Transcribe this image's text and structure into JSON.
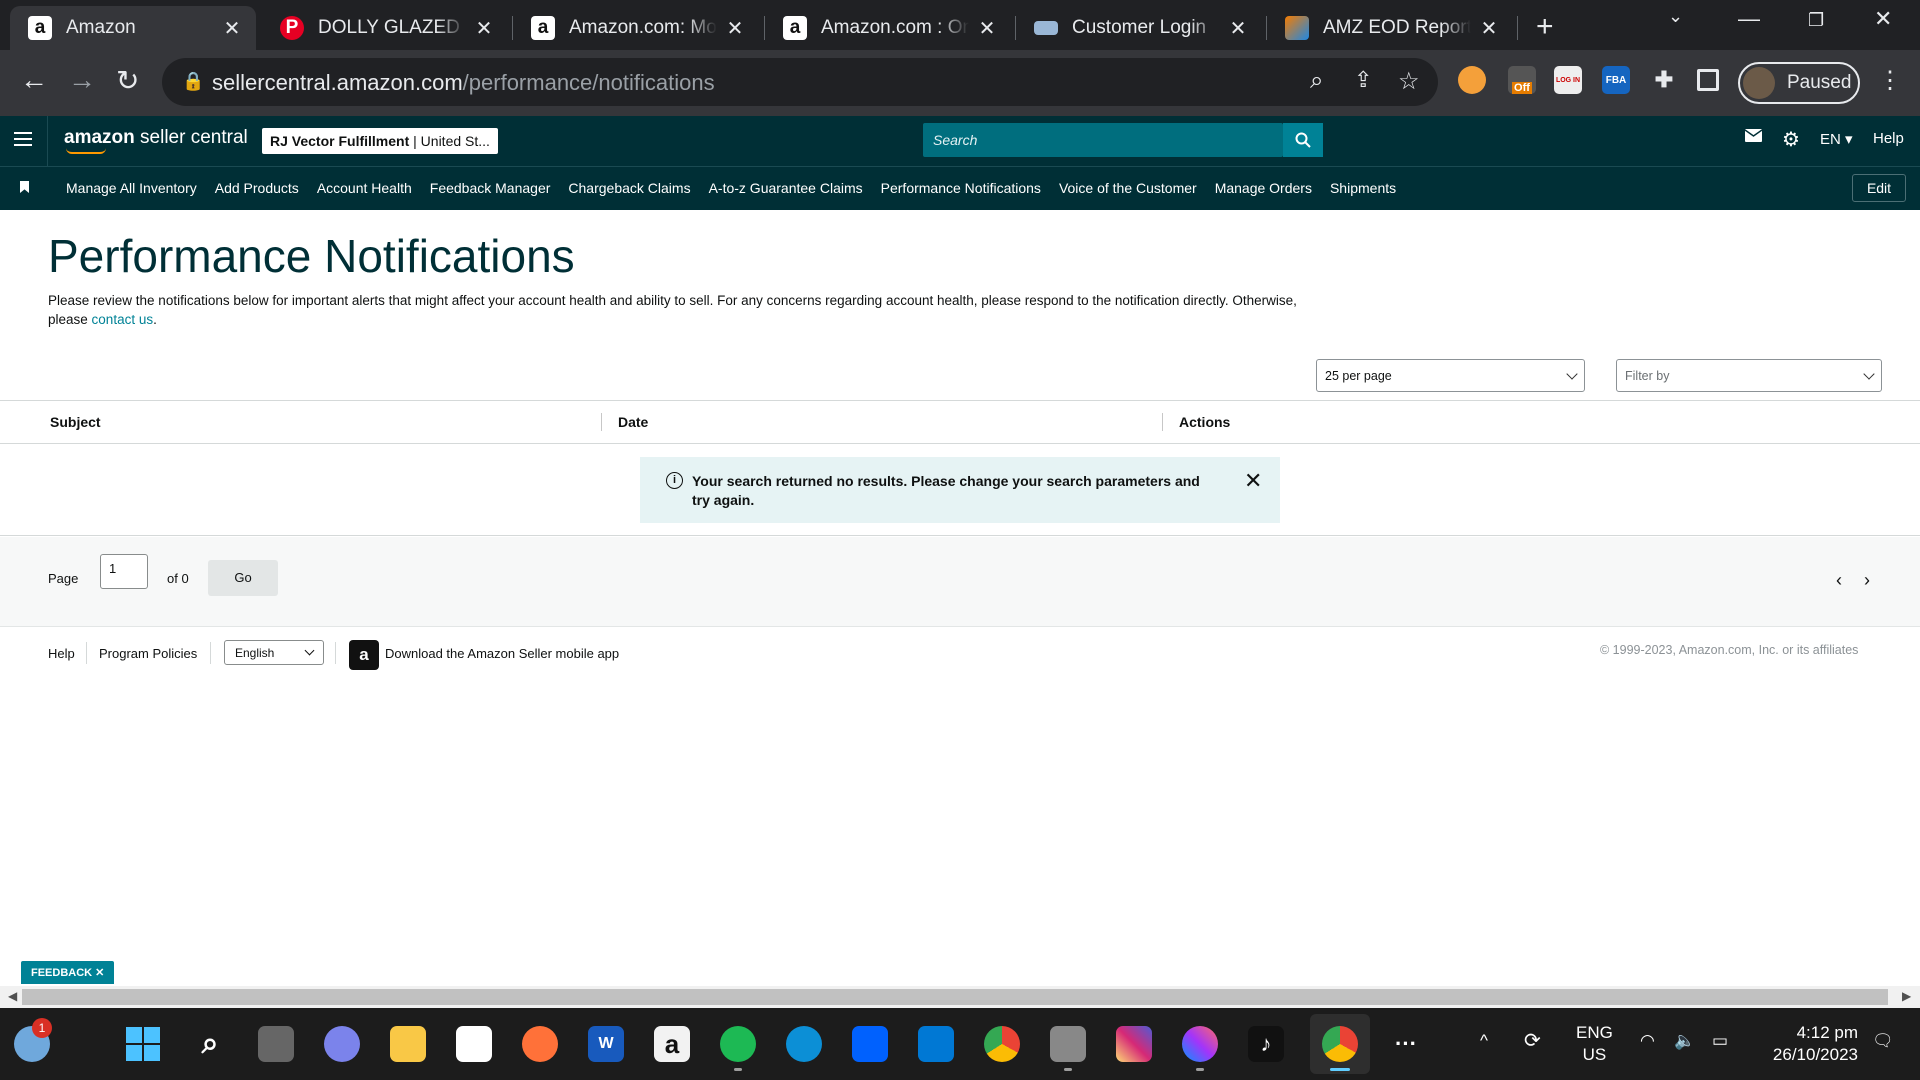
{
  "browser": {
    "tabs": [
      {
        "title": "Amazon",
        "favicon": "amazon-a",
        "active": true
      },
      {
        "title": "DOLLY GLAZED MI",
        "favicon": "pinterest-p"
      },
      {
        "title": "Amazon.com: Mon",
        "favicon": "amazon-a"
      },
      {
        "title": "Amazon.com : Ont",
        "favicon": "amazon-a"
      },
      {
        "title": "Customer Login",
        "favicon": "login-card"
      },
      {
        "title": "AMZ EOD Report",
        "favicon": "report-logo"
      }
    ],
    "url_host": "sellercentral.amazon.com",
    "url_path": "/performance/notifications",
    "extensions": {
      "off_badge": "Off",
      "login_ext": "LOG IN",
      "fba_ext": "FBA"
    },
    "profile_label": "Paused"
  },
  "header": {
    "logo_brand": "amazon",
    "logo_suffix": " seller central",
    "account_name": "RJ Vector Fulfillment",
    "account_region": " | United St...",
    "search_placeholder": "Search",
    "lang": "EN",
    "help": "Help"
  },
  "nav": {
    "items": [
      "Manage All Inventory",
      "Add Products",
      "Account Health",
      "Feedback Manager",
      "Chargeback Claims",
      "A-to-z Guarantee Claims",
      "Performance Notifications",
      "Voice of the Customer",
      "Manage Orders",
      "Shipments"
    ],
    "edit": "Edit"
  },
  "page": {
    "title": "Performance Notifications",
    "description": "Please review the notifications below for important alerts that might affect your account health and ability to sell. For any concerns regarding account health, please respond to the notification directly. Otherwise, please ",
    "contact_link": "contact us",
    "per_page": "25 per page",
    "filter_placeholder": "Filter by"
  },
  "table": {
    "columns": [
      "Subject",
      "Date",
      "Actions"
    ],
    "empty_message": "Your search returned no results. Please change your search parameters and try again."
  },
  "pager": {
    "page_label": "Page",
    "page_value": "1",
    "of_label": "of 0",
    "go": "Go"
  },
  "footer": {
    "help": "Help",
    "policies": "Program Policies",
    "language": "English",
    "app_link": "Download the Amazon Seller mobile app",
    "copyright": "© 1999-2023, Amazon.com, Inc. or its affiliates"
  },
  "feedback": "FEEDBACK",
  "taskbar": {
    "weather_badge": "1",
    "lang_line1": "ENG",
    "lang_line2": "US",
    "time": "4:12 pm",
    "date": "26/10/2023"
  },
  "colors": {
    "header_bg": "#002f36",
    "accent": "#008296",
    "chrome_dark": "#202124"
  }
}
